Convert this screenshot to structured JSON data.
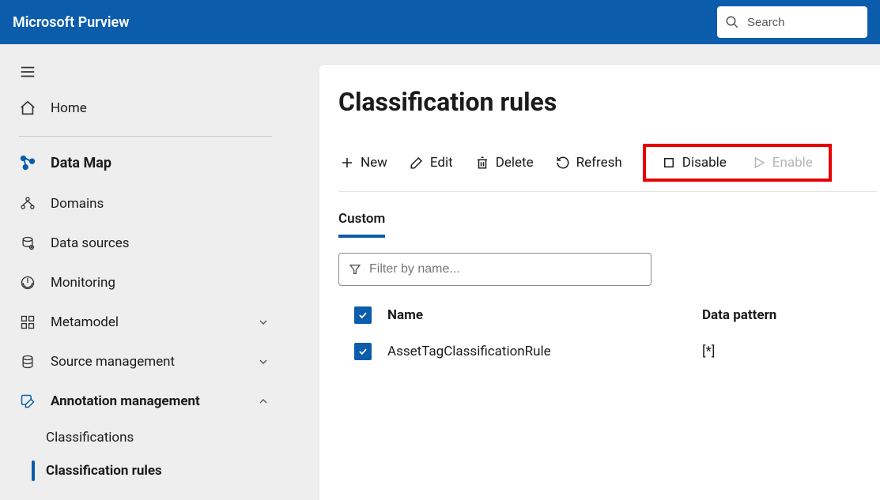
{
  "brand": "Microsoft Purview",
  "search": {
    "placeholder": "Search"
  },
  "sidebar": {
    "home": "Home",
    "section": "Data Map",
    "items": [
      {
        "label": "Domains"
      },
      {
        "label": "Data sources"
      },
      {
        "label": "Monitoring"
      },
      {
        "label": "Metamodel"
      },
      {
        "label": "Source management"
      },
      {
        "label": "Annotation management"
      }
    ],
    "subitems": [
      {
        "label": "Classifications"
      },
      {
        "label": "Classification rules"
      }
    ]
  },
  "page": {
    "title": "Classification rules",
    "toolbar": {
      "new": "New",
      "edit": "Edit",
      "delete": "Delete",
      "refresh": "Refresh",
      "disable": "Disable",
      "enable": "Enable"
    },
    "tabs": {
      "custom": "Custom"
    },
    "filter": {
      "placeholder": "Filter by name..."
    },
    "columns": {
      "name": "Name",
      "pattern": "Data pattern"
    },
    "rows": [
      {
        "name": "AssetTagClassificationRule",
        "pattern": "[*]"
      }
    ]
  }
}
